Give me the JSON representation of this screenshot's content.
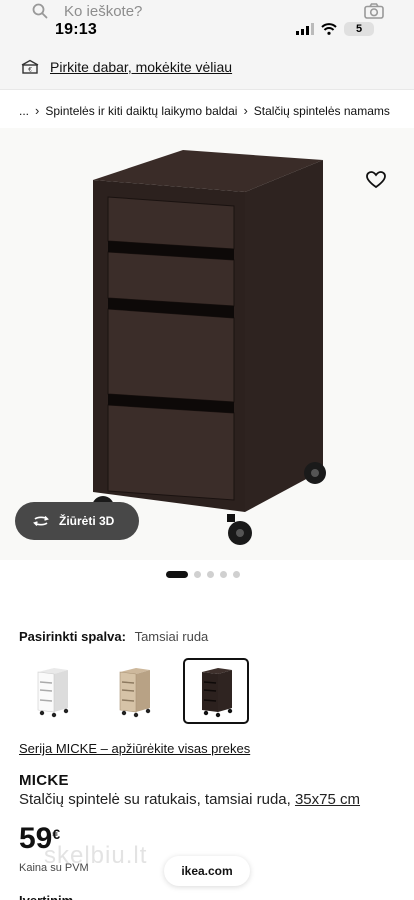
{
  "search": {
    "placeholder": "Ko ieškote?"
  },
  "status_bar": {
    "time": "19:13",
    "battery": "5"
  },
  "banner": {
    "pay_later": "Pirkite dabar, mokėkite vėliau"
  },
  "breadcrumb": {
    "ellipsis": "...",
    "items": [
      "Spintelės ir kiti daiktų laikymo baldai",
      "Stalčių spintelės namams"
    ]
  },
  "product_image": {
    "view_3d_label": "Žiūrėti 3D"
  },
  "carousel": {
    "slide_count": 5,
    "active_slide": 1
  },
  "color": {
    "label": "Pasirinkti spalva:",
    "value": "Tamsiai ruda",
    "options": [
      "white",
      "oak-effect",
      "dark-brown"
    ],
    "selected": "dark-brown"
  },
  "series_link": "Serija MICKE – apžiūrėkite visas prekes",
  "product": {
    "name": "MICKE",
    "description": "Stalčių spintelė su ratukais, tamsiai ruda, ",
    "size": "35x75 cm",
    "price": "59",
    "currency": "€",
    "price_note": "Kaina su PVM"
  },
  "watermark": "skelbiu.lt",
  "browser": {
    "url": "ikea.com"
  },
  "cut_off_heading": "Įvertinim"
}
